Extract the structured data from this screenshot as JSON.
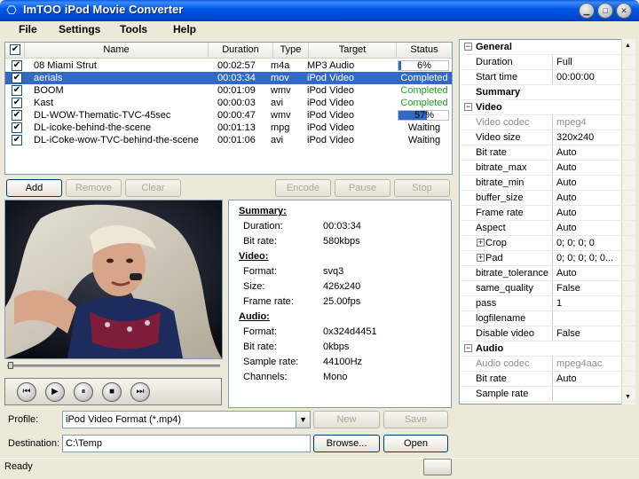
{
  "window": {
    "title": "ImTOO iPod Movie Converter",
    "app_icon": "ipod-icon",
    "controls": {
      "minimize_icon": "minimize-icon",
      "maximize_icon": "maximize-icon",
      "close_icon": "close-icon"
    }
  },
  "menu": {
    "file": "File",
    "settings": "Settings",
    "tools": "Tools",
    "help": "Help"
  },
  "file_list": {
    "columns": {
      "check": "",
      "name": "Name",
      "duration": "Duration",
      "type": "Type",
      "target": "Target",
      "status": "Status"
    },
    "rows": [
      {
        "checked": true,
        "name": "08 Miami Strut",
        "duration": "00:02:57",
        "type": "m4a",
        "target": "MP3 Audio",
        "status": "6%",
        "progress": 0.06,
        "selected": false
      },
      {
        "checked": true,
        "name": "aerials",
        "duration": "00:03:34",
        "type": "mov",
        "target": "iPod Video",
        "status": "Completed",
        "selected": true
      },
      {
        "checked": true,
        "name": "BOOM",
        "duration": "00:01:09",
        "type": "wmv",
        "target": "iPod Video",
        "status": "Completed",
        "selected": false
      },
      {
        "checked": true,
        "name": "Kast",
        "duration": "00:00:03",
        "type": "avi",
        "target": "iPod Video",
        "status": "Completed",
        "selected": false
      },
      {
        "checked": true,
        "name": "DL-WOW-Thematic-TVC-45sec",
        "duration": "00:00:47",
        "type": "wmv",
        "target": "iPod Video",
        "status": "57%",
        "progress": 0.57,
        "selected": false
      },
      {
        "checked": true,
        "name": "DL-icoke-behind-the-scene",
        "duration": "00:01:13",
        "type": "mpg",
        "target": "iPod Video",
        "status": "Waiting",
        "selected": false
      },
      {
        "checked": true,
        "name": "DL-iCoke-wow-TVC-behind-the-scene",
        "duration": "00:01:06",
        "type": "avi",
        "target": "iPod Video",
        "status": "Waiting",
        "selected": false
      }
    ],
    "status_colors": {
      "completed": "#21a121",
      "waiting": "#000000",
      "progress": "#316ac5"
    }
  },
  "actions": {
    "add": "Add",
    "remove": "Remove",
    "clear": "Clear",
    "encode": "Encode",
    "pause": "Pause",
    "stop": "Stop"
  },
  "info": {
    "summary_heading": "Summary:",
    "duration_label": "Duration:",
    "duration": "00:03:34",
    "bitrate_label": "Bit rate:",
    "bitrate": "580kbps",
    "video_heading": "Video:",
    "v_format_label": "Format:",
    "v_format": "svq3",
    "v_size_label": "Size:",
    "v_size": "426x240",
    "v_fps_label": "Frame rate:",
    "v_fps": "25.00fps",
    "audio_heading": "Audio:",
    "a_format_label": "Format:",
    "a_format": "0x324d4451",
    "a_bitrate_label": "Bit rate:",
    "a_bitrate": "0kbps",
    "a_sample_label": "Sample rate:",
    "a_sample": "44100Hz",
    "a_channels_label": "Channels:",
    "a_channels": "Mono"
  },
  "player": {
    "preview_icon": "video-preview",
    "prev_icon": "previous-icon",
    "play_icon": "play-icon",
    "pause_icon": "pause-icon",
    "stop_icon": "stop-icon",
    "next_icon": "next-icon",
    "position": 0.0
  },
  "profile": {
    "label": "Profile:",
    "value": "iPod Video Format  (*.mp4)",
    "new": "New",
    "save": "Save"
  },
  "destination": {
    "label": "Destination:",
    "value": "C:\\Temp",
    "browse": "Browse...",
    "open": "Open"
  },
  "statusbar": {
    "text": "Ready"
  },
  "properties": {
    "general": "General",
    "duration_name": "Duration",
    "duration_val": "Full",
    "start_name": "Start time",
    "start_val": "00:00:00",
    "summary": "Summary",
    "video": "Video",
    "vcodec_name": "Video codec",
    "vcodec_val": "mpeg4",
    "vsize_name": "Video size",
    "vsize_val": "320x240",
    "bitrate_name": "Bit rate",
    "bitrate_val": "Auto",
    "bmax_name": "bitrate_max",
    "bmax_val": "Auto",
    "bmin_name": "bitrate_min",
    "bmin_val": "Auto",
    "buf_name": "buffer_size",
    "buf_val": "Auto",
    "fr_name": "Frame rate",
    "fr_val": "Auto",
    "aspect_name": "Aspect",
    "aspect_val": "Auto",
    "crop_name": "Crop",
    "crop_val": "0; 0; 0; 0",
    "pad_name": "Pad",
    "pad_val": "0; 0; 0; 0; 0...",
    "btol_name": "bitrate_tolerance",
    "btol_val": "Auto",
    "sq_name": "same_quality",
    "sq_val": "False",
    "pass_name": "pass",
    "pass_val": "1",
    "log_name": "logfilename",
    "log_val": "",
    "dv_name": "Disable video",
    "dv_val": "False",
    "audio": "Audio",
    "acodec_name": "Audio codec",
    "acodec_val": "mpeg4aac",
    "abitrate_name": "Bit rate",
    "abitrate_val": "Auto",
    "asr_name": "Sample rate",
    "asr_val": ""
  }
}
